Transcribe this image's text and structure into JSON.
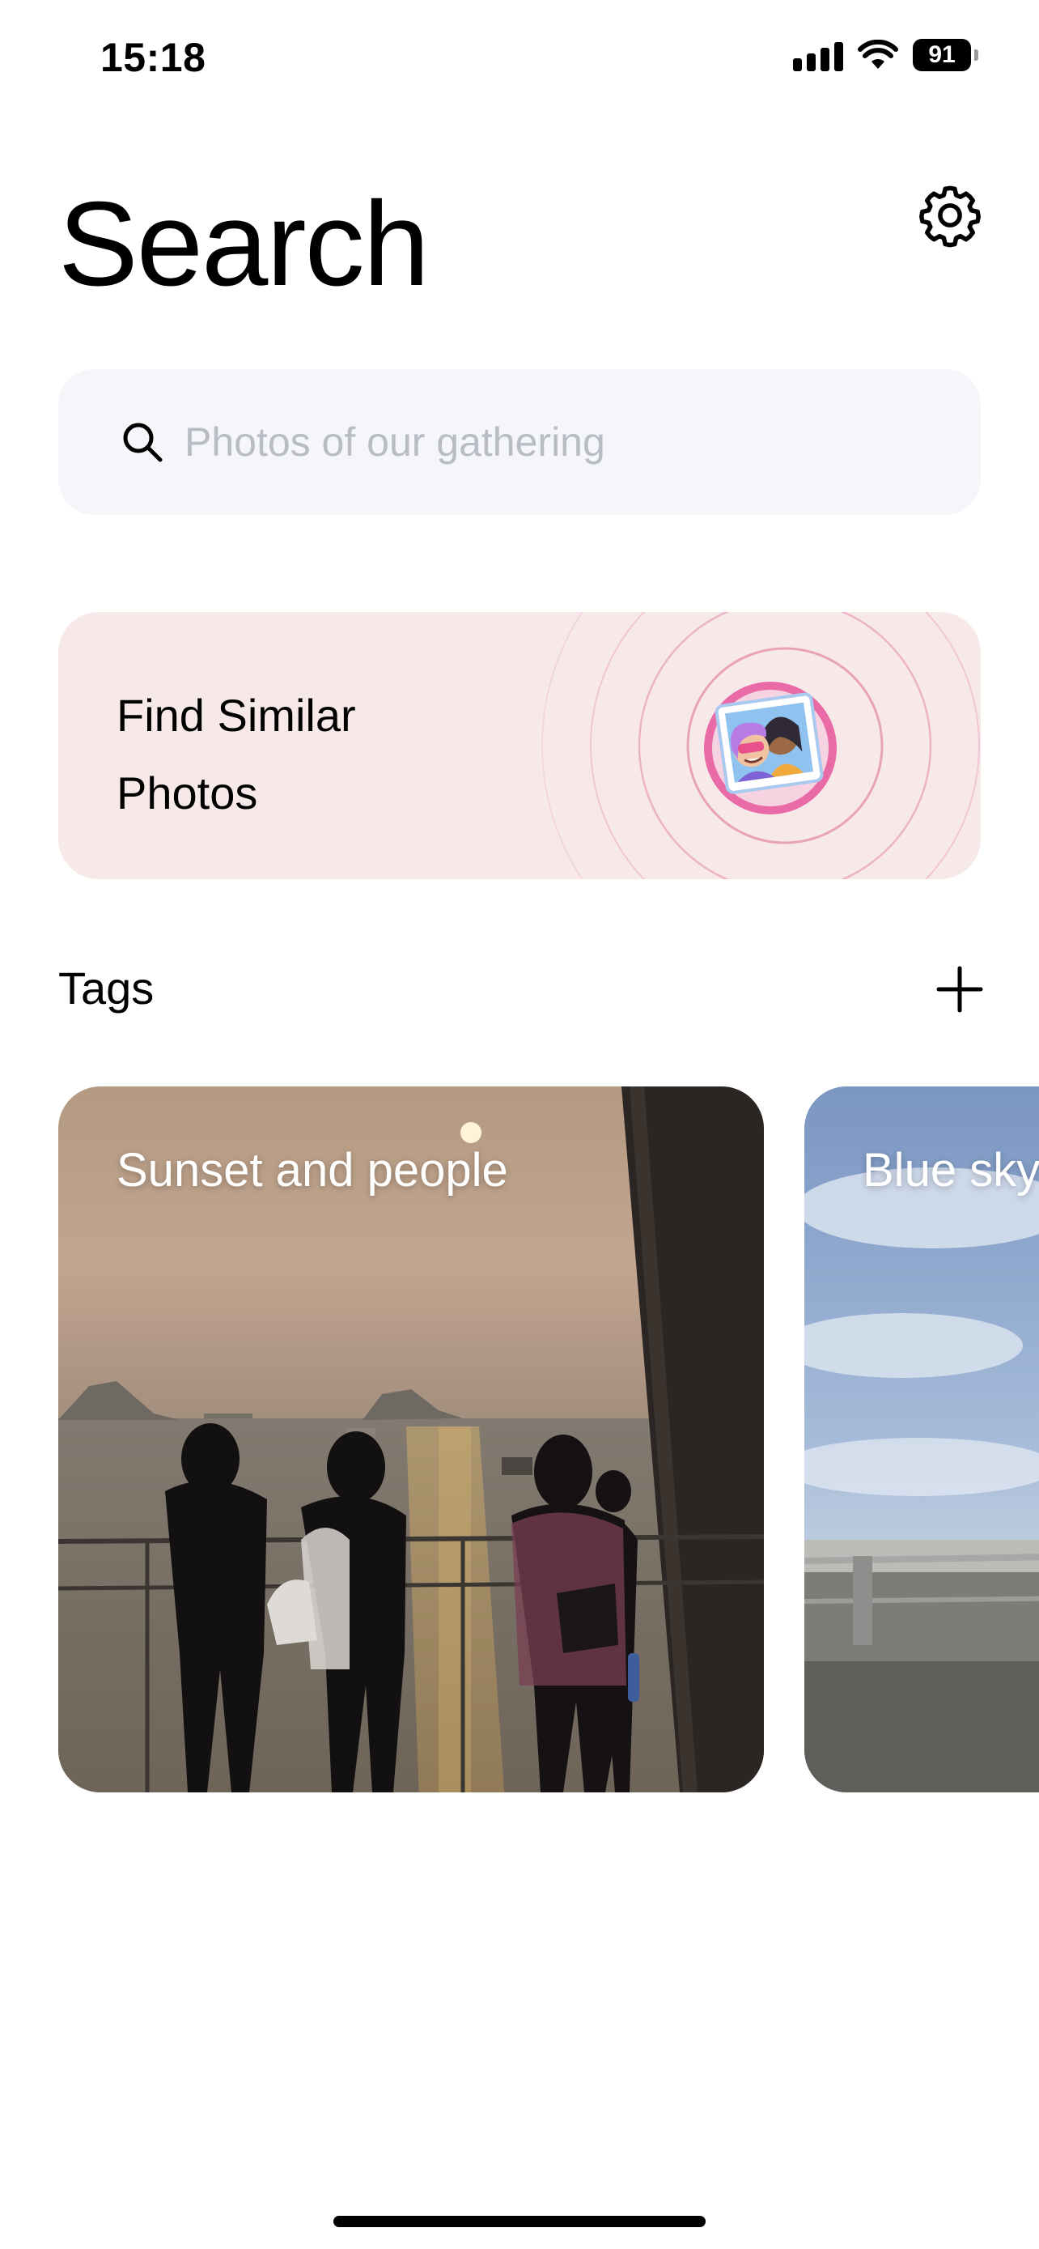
{
  "status_bar": {
    "time": "15:18",
    "battery": "91",
    "icons": [
      "signal-icon",
      "wifi-icon",
      "battery-icon"
    ]
  },
  "header": {
    "title": "Search",
    "settings_icon": "gear-icon"
  },
  "search": {
    "placeholder": "Photos of our gathering",
    "value": "",
    "icon": "search-icon"
  },
  "find_similar": {
    "label": "Find Similar Photos",
    "icon": "photo-avatar-icon"
  },
  "tags": {
    "title": "Tags",
    "add_icon": "plus-icon",
    "items": [
      {
        "label": "Sunset and people"
      },
      {
        "label": "Blue sky"
      }
    ]
  },
  "colors": {
    "search_background": "#f5f6fa",
    "placeholder": "#b9bcc5",
    "similar_card_background": "#f8e9e9",
    "ripple": "#e8a3b5",
    "avatar_ring": "#e86aa6"
  }
}
